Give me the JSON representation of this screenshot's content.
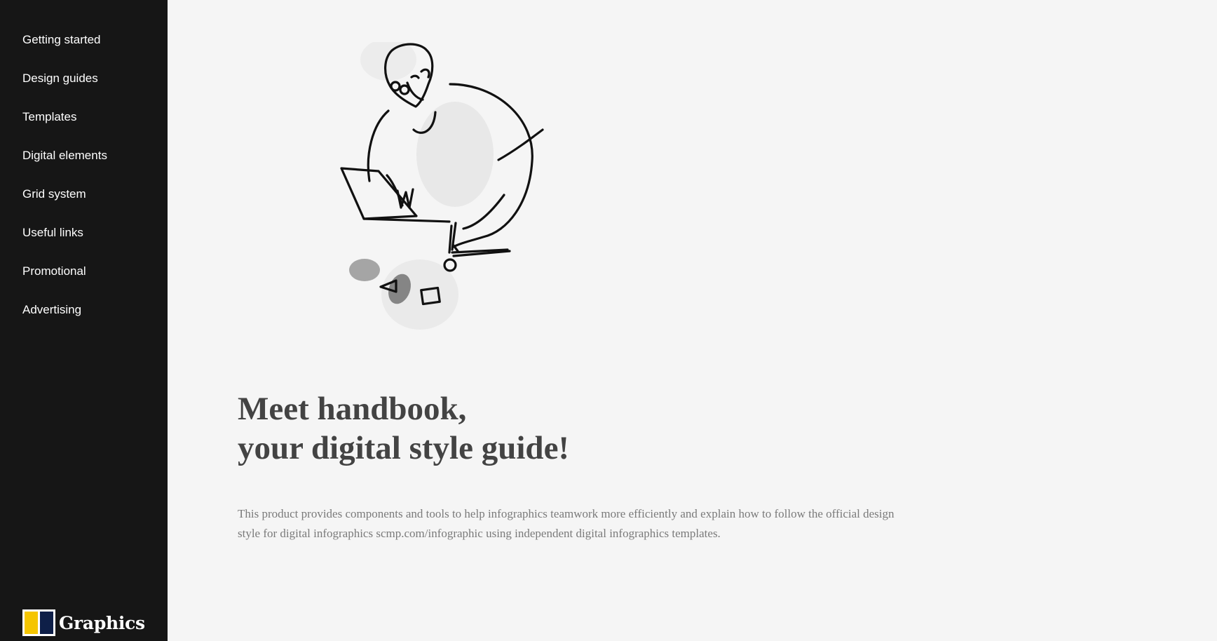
{
  "sidebar": {
    "items": [
      {
        "label": "Getting started"
      },
      {
        "label": "Design guides"
      },
      {
        "label": "Templates"
      },
      {
        "label": "Digital elements"
      },
      {
        "label": "Grid system"
      },
      {
        "label": "Useful links"
      },
      {
        "label": "Promotional"
      },
      {
        "label": "Advertising"
      }
    ],
    "brand": {
      "name": "Graphics",
      "logo_colors": [
        "#f5c500",
        "#0e1f48"
      ]
    }
  },
  "hero": {
    "title_line1": "Meet handbook,",
    "title_line2": "your digital style guide!",
    "description": "This product provides components and tools to help infographics teamwork more efficiently and explain how to follow the official design style for digital infographics scmp.com/infographic using independent digital infographics templates.",
    "illustration": "person-working-on-laptop-sketch"
  },
  "colors": {
    "sidebar_bg": "#161616",
    "page_bg": "#f5f5f5",
    "title_text": "#434343",
    "body_text": "#7a7a7a"
  }
}
